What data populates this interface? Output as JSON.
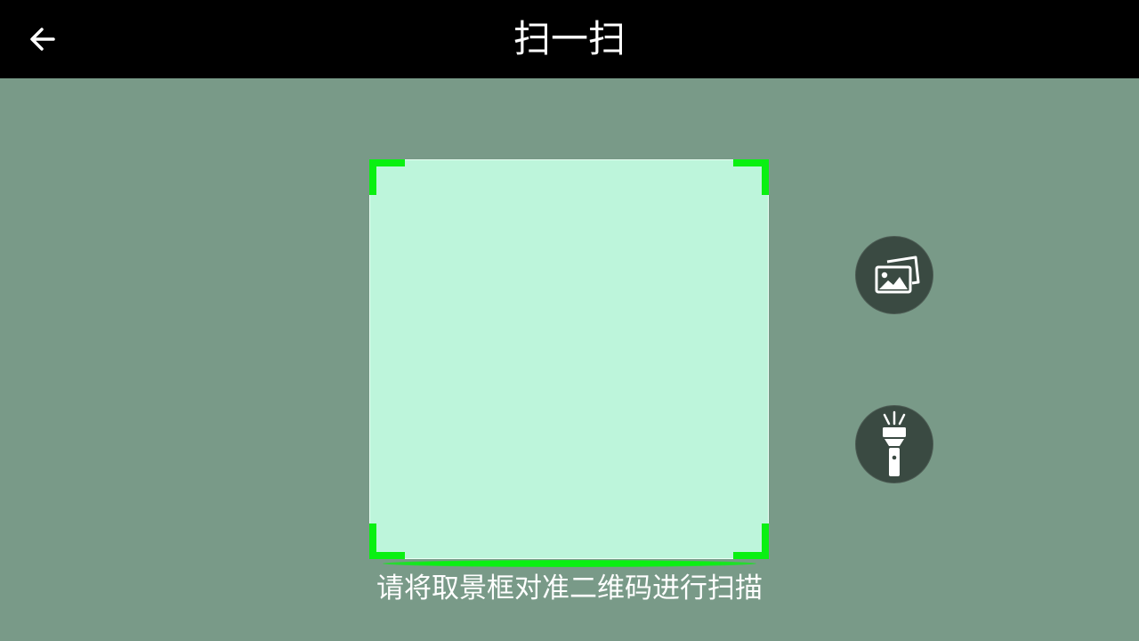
{
  "header": {
    "title": "扫一扫",
    "back_icon": "arrow-left-icon"
  },
  "scanner": {
    "hint": "请将取景框对准二维码进行扫描",
    "frame_color": "#bdf5db",
    "corner_color": "#0af012"
  },
  "actions": {
    "gallery_icon": "image-gallery-icon",
    "flashlight_icon": "flashlight-icon"
  },
  "colors": {
    "background": "#799a88",
    "topbar": "#000000",
    "button_bg": "#3a4a42"
  }
}
